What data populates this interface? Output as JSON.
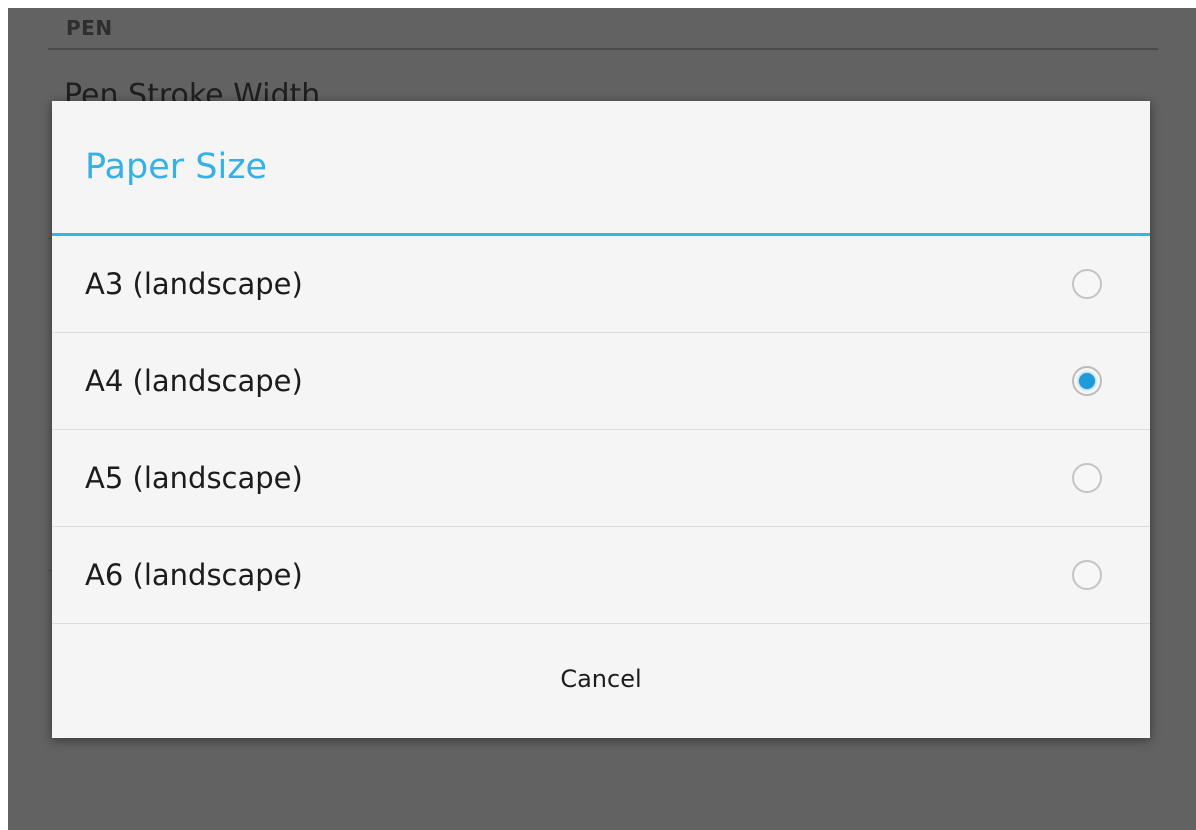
{
  "background": {
    "section_header": "PEN",
    "item_title": "Pen Stroke Width"
  },
  "dialog": {
    "title": "Paper Size",
    "options": [
      {
        "label": "A3 (landscape)",
        "selected": false
      },
      {
        "label": "A4 (landscape)",
        "selected": true
      },
      {
        "label": "A5 (landscape)",
        "selected": false
      },
      {
        "label": "A6 (landscape)",
        "selected": false
      }
    ],
    "cancel_label": "Cancel"
  },
  "colors": {
    "accent": "#33b5e5",
    "radio_selected": "#1e9bd8",
    "scrim": "#626262"
  }
}
